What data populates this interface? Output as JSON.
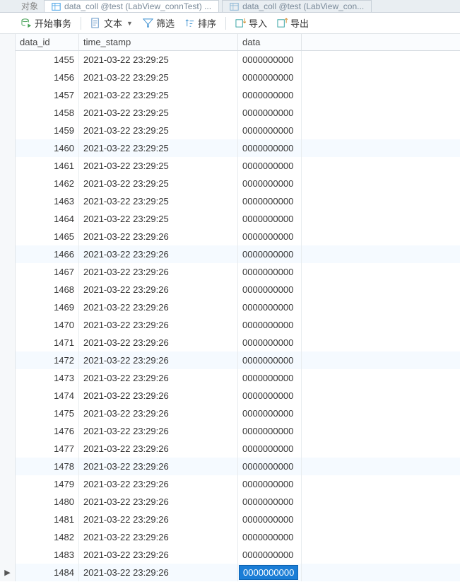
{
  "tabs": {
    "prefix": "对象",
    "active": "data_coll @test (LabView_connTest) ...",
    "inactive": "data_coll @test (LabView_con..."
  },
  "toolbar": {
    "begin_tx": "开始事务",
    "text": "文本",
    "filter": "筛选",
    "sort": "排序",
    "import": "导入",
    "export": "导出"
  },
  "columns": {
    "id": "data_id",
    "ts": "time_stamp",
    "data": "data"
  },
  "current_indicator": "▶",
  "rows": [
    {
      "id": "1455",
      "ts": "2021-03-22 23:29:25",
      "data": "0000000000"
    },
    {
      "id": "1456",
      "ts": "2021-03-22 23:29:25",
      "data": "0000000000"
    },
    {
      "id": "1457",
      "ts": "2021-03-22 23:29:25",
      "data": "0000000000"
    },
    {
      "id": "1458",
      "ts": "2021-03-22 23:29:25",
      "data": "0000000000"
    },
    {
      "id": "1459",
      "ts": "2021-03-22 23:29:25",
      "data": "0000000000"
    },
    {
      "id": "1460",
      "ts": "2021-03-22 23:29:25",
      "data": "0000000000"
    },
    {
      "id": "1461",
      "ts": "2021-03-22 23:29:25",
      "data": "0000000000"
    },
    {
      "id": "1462",
      "ts": "2021-03-22 23:29:25",
      "data": "0000000000"
    },
    {
      "id": "1463",
      "ts": "2021-03-22 23:29:25",
      "data": "0000000000"
    },
    {
      "id": "1464",
      "ts": "2021-03-22 23:29:25",
      "data": "0000000000"
    },
    {
      "id": "1465",
      "ts": "2021-03-22 23:29:26",
      "data": "0000000000"
    },
    {
      "id": "1466",
      "ts": "2021-03-22 23:29:26",
      "data": "0000000000"
    },
    {
      "id": "1467",
      "ts": "2021-03-22 23:29:26",
      "data": "0000000000"
    },
    {
      "id": "1468",
      "ts": "2021-03-22 23:29:26",
      "data": "0000000000"
    },
    {
      "id": "1469",
      "ts": "2021-03-22 23:29:26",
      "data": "0000000000"
    },
    {
      "id": "1470",
      "ts": "2021-03-22 23:29:26",
      "data": "0000000000"
    },
    {
      "id": "1471",
      "ts": "2021-03-22 23:29:26",
      "data": "0000000000"
    },
    {
      "id": "1472",
      "ts": "2021-03-22 23:29:26",
      "data": "0000000000"
    },
    {
      "id": "1473",
      "ts": "2021-03-22 23:29:26",
      "data": "0000000000"
    },
    {
      "id": "1474",
      "ts": "2021-03-22 23:29:26",
      "data": "0000000000"
    },
    {
      "id": "1475",
      "ts": "2021-03-22 23:29:26",
      "data": "0000000000"
    },
    {
      "id": "1476",
      "ts": "2021-03-22 23:29:26",
      "data": "0000000000"
    },
    {
      "id": "1477",
      "ts": "2021-03-22 23:29:26",
      "data": "0000000000"
    },
    {
      "id": "1478",
      "ts": "2021-03-22 23:29:26",
      "data": "0000000000"
    },
    {
      "id": "1479",
      "ts": "2021-03-22 23:29:26",
      "data": "0000000000"
    },
    {
      "id": "1480",
      "ts": "2021-03-22 23:29:26",
      "data": "0000000000"
    },
    {
      "id": "1481",
      "ts": "2021-03-22 23:29:26",
      "data": "0000000000"
    },
    {
      "id": "1482",
      "ts": "2021-03-22 23:29:26",
      "data": "0000000000"
    },
    {
      "id": "1483",
      "ts": "2021-03-22 23:29:26",
      "data": "0000000000"
    },
    {
      "id": "1484",
      "ts": "2021-03-22 23:29:26",
      "data": "0000000000"
    }
  ],
  "selected_row_index": 29
}
